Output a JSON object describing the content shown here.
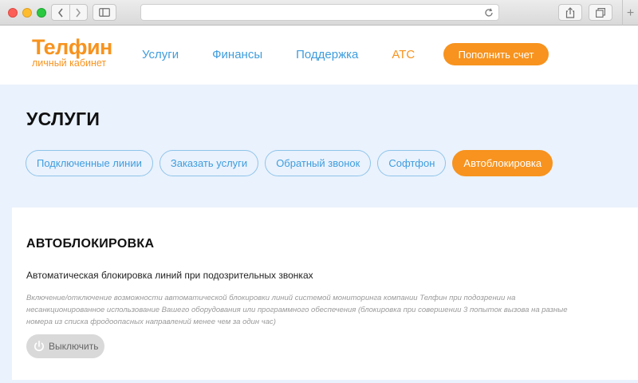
{
  "browser": {
    "icons": {
      "back": "chevron-left-icon",
      "forward": "chevron-right-icon",
      "sidebar": "sidebar-icon",
      "reload": "reload-icon",
      "share": "share-icon",
      "tabs": "tabs-icon",
      "new_tab": "plus-icon"
    },
    "new_tab_label": "+"
  },
  "header": {
    "logo": {
      "main": "Телфин",
      "sub": "личный кабинет"
    },
    "nav": [
      {
        "label": "Услуги",
        "active": false
      },
      {
        "label": "Финансы",
        "active": false
      },
      {
        "label": "Поддержка",
        "active": false
      },
      {
        "label": "АТС",
        "active": true
      }
    ],
    "topup_label": "Пополнить счет"
  },
  "services": {
    "title": "УСЛУГИ",
    "tabs": [
      {
        "label": "Подключенные линии",
        "active": false
      },
      {
        "label": "Заказать услуги",
        "active": false
      },
      {
        "label": "Обратный звонок",
        "active": false
      },
      {
        "label": "Софтфон",
        "active": false
      },
      {
        "label": "Автоблокировка",
        "active": true
      }
    ]
  },
  "card": {
    "title": "АВТОБЛОКИРОВКА",
    "subtitle": "Автоматическая блокировка линий при подозрительных звонках",
    "description": "Включение/отключение возможности автоматической блокировки линий системой мониторинга компании Телфин при подозрении на несанкционированное использование Вашего оборудования или программного обеспечения (блокировка при совершении 3 попыток вызова на разные номера из списка фродоопасных направлений менее чем за один час)",
    "button_label": "Выключить",
    "button_icon": "power-icon"
  },
  "colors": {
    "accent": "#f7931e",
    "link": "#3f9ddd",
    "band": "#eaf2fd"
  }
}
